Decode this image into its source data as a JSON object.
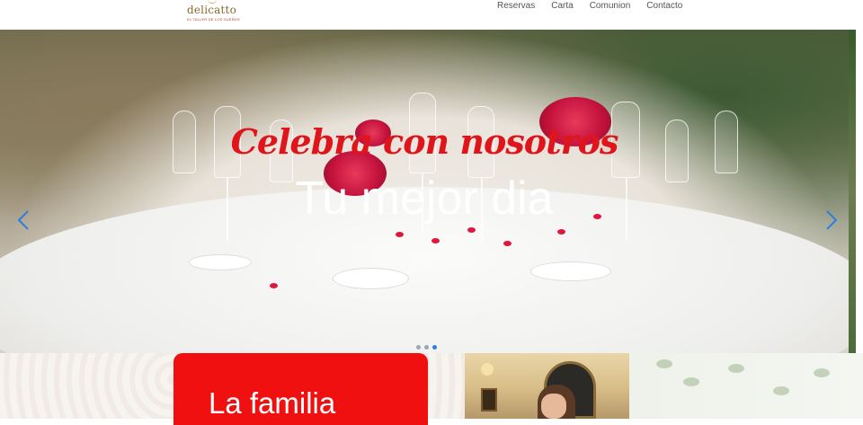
{
  "header": {
    "logo": {
      "word": "delicatto",
      "tagline": "EL TALLER DE LOS SUEÑOS"
    },
    "nav": [
      {
        "label": "Reservas"
      },
      {
        "label": "Carta"
      },
      {
        "label": "Comunion"
      },
      {
        "label": "Contacto"
      }
    ]
  },
  "hero": {
    "subtitle": "Celebra con nosotros",
    "title": "Tu mejor dia",
    "slides_count": 3,
    "active_slide": 3,
    "colors": {
      "subtitle": "#e0141b",
      "title": "#ffffff",
      "dot_active": "#2f7de0",
      "dot": "#9aa7b5"
    }
  },
  "sections": {
    "family_card": {
      "title": "La familia",
      "color": "#f01010"
    }
  }
}
